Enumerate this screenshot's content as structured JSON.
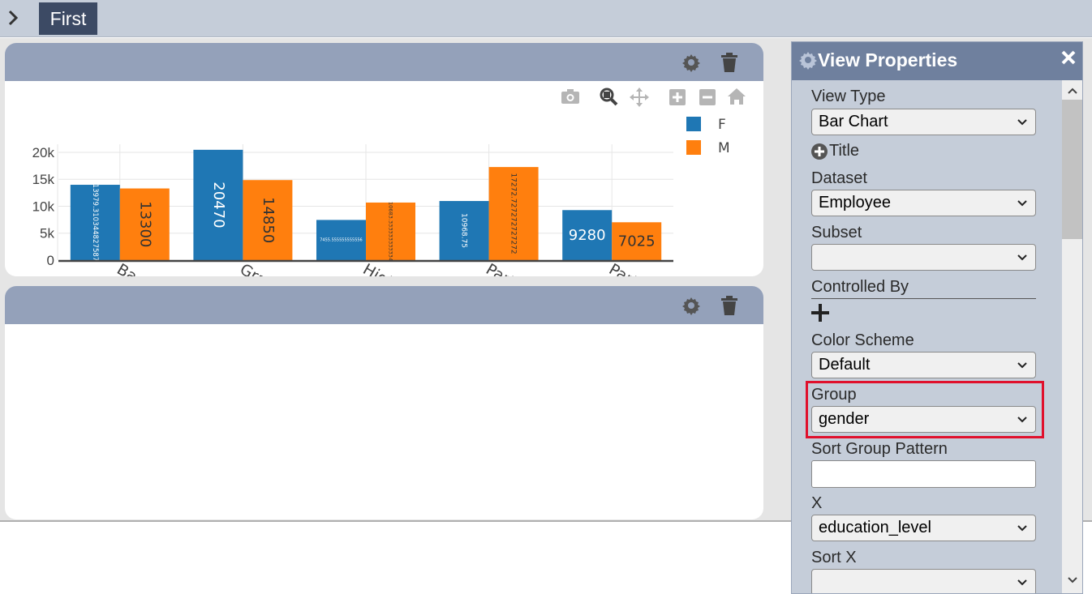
{
  "tabs": [
    {
      "label": "First"
    }
  ],
  "props": {
    "title": "View Properties",
    "fields": {
      "view_type": {
        "label": "View Type",
        "value": "Bar Chart"
      },
      "title": {
        "label": "Title"
      },
      "dataset": {
        "label": "Dataset",
        "value": "Employee"
      },
      "subset": {
        "label": "Subset",
        "value": ""
      },
      "controlled_by": {
        "label": "Controlled By"
      },
      "color_scheme": {
        "label": "Color Scheme",
        "value": "Default"
      },
      "group": {
        "label": "Group",
        "value": "gender"
      },
      "sort_group_pattern": {
        "label": "Sort Group Pattern",
        "value": ""
      },
      "x": {
        "label": "X",
        "value": "education_level"
      },
      "sort_x": {
        "label": "Sort X",
        "value": ""
      }
    }
  },
  "icons": {
    "sidebar_toggle": "chevron-right-icon",
    "panel_settings": "gear-icon",
    "panel_delete": "trash-icon",
    "modebar": [
      "camera-icon",
      "zoom-icon",
      "pan-icon",
      "zoom-in-icon",
      "zoom-out-icon",
      "home-icon"
    ],
    "props_close": "close-icon"
  },
  "colors": {
    "F": "#1f77b4",
    "M": "#ff7f0e",
    "highlight": "#e0102c"
  },
  "chart_data": {
    "type": "bar",
    "categories": [
      "Bachelors D",
      "Graduate D",
      "High School",
      "Partial College",
      "Partial High School"
    ],
    "tick_labels": [
      "Bachelors D",
      "Graduate D",
      "High Scho",
      "Partial Coll",
      "Partial High"
    ],
    "series": [
      {
        "name": "F",
        "values": [
          13979.310344827587,
          20470,
          7455.555555555556,
          10968.75,
          9280
        ],
        "labels": [
          "13979.310344827587",
          "20470",
          "7455.555555555556",
          "10968.75",
          "9280"
        ]
      },
      {
        "name": "M",
        "values": [
          13300,
          14850,
          10683.333333333334,
          17272.727272727272,
          7025
        ],
        "labels": [
          "13300",
          "14850",
          "10683.333333333334",
          "17272.727272727272",
          "7025"
        ]
      }
    ],
    "ylim": [
      0,
      21500
    ],
    "yticks": [
      0,
      5000,
      10000,
      15000,
      20000
    ],
    "ytick_labels": [
      "0",
      "5k",
      "10k",
      "15k",
      "20k"
    ],
    "legend": "top-right",
    "grid": true,
    "xlabel": "",
    "ylabel": ""
  }
}
